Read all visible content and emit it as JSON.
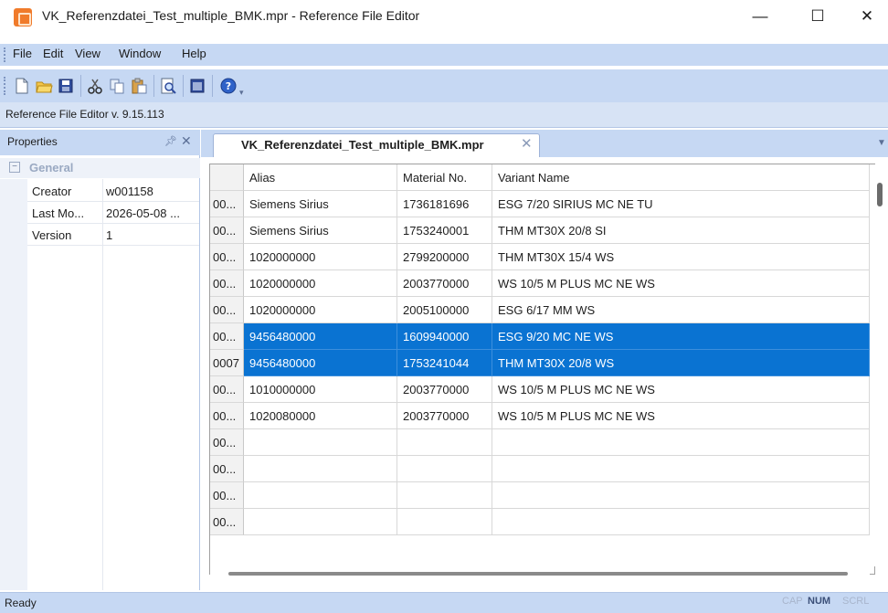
{
  "window": {
    "title": "VK_Referenzdatei_Test_multiple_BMK.mpr - Reference File Editor",
    "controls": {
      "minimize": "—",
      "maximize": "☐",
      "close": "✕"
    }
  },
  "menu": {
    "file": "File",
    "edit": "Edit",
    "view": "View",
    "window": "Window",
    "help": "Help"
  },
  "version_strip": "Reference File Editor v. 9.15.113",
  "properties": {
    "title": "Properties",
    "category": "General",
    "rows": [
      {
        "name": "Creator",
        "value": "w001158"
      },
      {
        "name": "Last Mo...",
        "value": "2026-05-08 ..."
      },
      {
        "name": "Version",
        "value": "1"
      }
    ]
  },
  "document_tab": {
    "label": "VK_Referenzdatei_Test_multiple_BMK.mpr"
  },
  "grid": {
    "columns": [
      "Alias",
      "Material No.",
      "Variant Name"
    ],
    "rows": [
      {
        "id": "00...",
        "alias": "Siemens Sirius",
        "material": "1736181696",
        "variant": "ESG 7/20 SIRIUS MC NE TU",
        "selected": false
      },
      {
        "id": "00...",
        "alias": "Siemens Sirius",
        "material": "1753240001",
        "variant": "THM MT30X 20/8 SI",
        "selected": false
      },
      {
        "id": "00...",
        "alias": "1020000000",
        "material": "2799200000",
        "variant": "THM MT30X 15/4 WS",
        "selected": false
      },
      {
        "id": "00...",
        "alias": "1020000000",
        "material": "2003770000",
        "variant": "WS 10/5 M PLUS MC NE WS",
        "selected": false
      },
      {
        "id": "00...",
        "alias": "1020000000",
        "material": "2005100000",
        "variant": "ESG 6/17 MM WS",
        "selected": false
      },
      {
        "id": "00...",
        "alias": "9456480000",
        "material": "1609940000",
        "variant": "ESG 9/20 MC NE WS",
        "selected": true
      },
      {
        "id": "0007",
        "alias": "9456480000",
        "material": "1753241044",
        "variant": "THM MT30X 20/8 WS",
        "selected": true
      },
      {
        "id": "00...",
        "alias": "1010000000",
        "material": "2003770000",
        "variant": "WS 10/5 M PLUS MC NE WS",
        "selected": false
      },
      {
        "id": "00...",
        "alias": "1020080000",
        "material": "2003770000",
        "variant": "WS 10/5 M PLUS MC NE WS",
        "selected": false
      },
      {
        "id": "00...",
        "alias": "",
        "material": "",
        "variant": "",
        "selected": false
      },
      {
        "id": "00...",
        "alias": "",
        "material": "",
        "variant": "",
        "selected": false
      },
      {
        "id": "00...",
        "alias": "",
        "material": "",
        "variant": "",
        "selected": false
      },
      {
        "id": "00...",
        "alias": "",
        "material": "",
        "variant": "",
        "selected": false
      }
    ]
  },
  "status": {
    "text": "Ready",
    "cap": "CAP",
    "num": "NUM",
    "scrl": "SCRL"
  },
  "colors": {
    "chrome": "#c6d8f3",
    "selection": "#0a73d2",
    "app_icon": "#f07b2b"
  }
}
